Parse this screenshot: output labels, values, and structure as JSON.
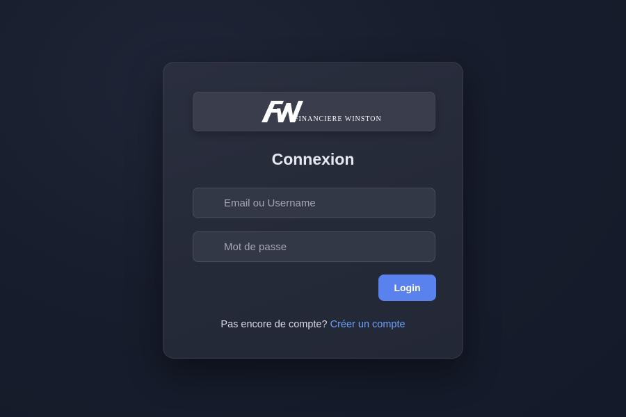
{
  "brand": {
    "logo_text": "FINANCIERE WINSTON"
  },
  "form": {
    "title": "Connexion",
    "email_placeholder": "Email ou Username",
    "password_placeholder": "Mot de passe",
    "login_label": "Login"
  },
  "signup": {
    "prompt": "Pas encore de compte?",
    "link_label": "Créer un compte"
  },
  "colors": {
    "accent": "#5a82ee",
    "link": "#6ea0f7",
    "background": "#171d2c",
    "card": "#262b39"
  }
}
